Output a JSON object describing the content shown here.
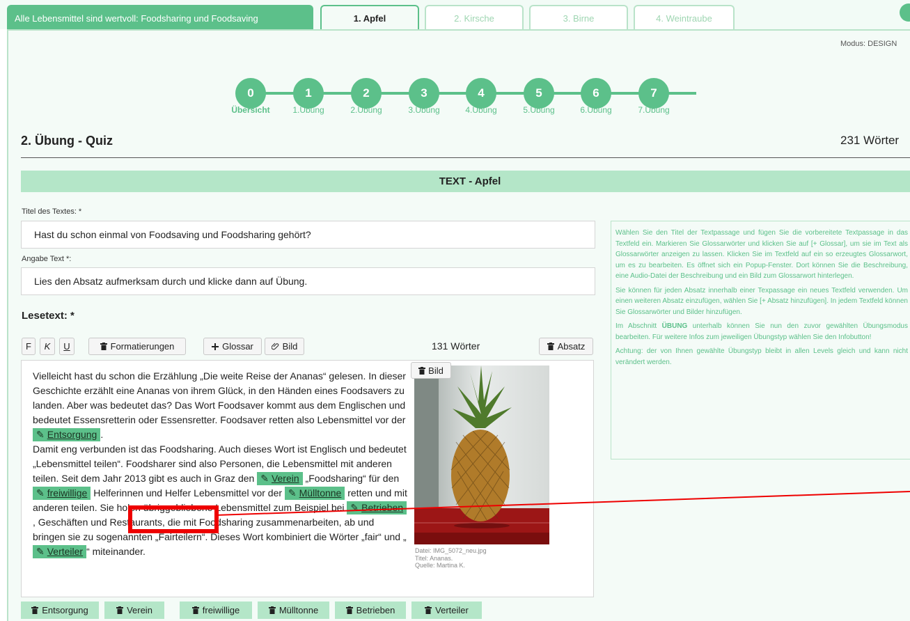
{
  "tabs": [
    {
      "label": "Alle Lebensmittel sind wertvoll: Foodsharing und Foodsaving"
    },
    {
      "label": "1. Apfel"
    },
    {
      "label": "2. Kirsche"
    },
    {
      "label": "3. Birne"
    },
    {
      "label": "4. Weintraube"
    }
  ],
  "mode_label": "Modus: DESIGN",
  "steps": [
    {
      "num": "0",
      "label": "Übersicht"
    },
    {
      "num": "1",
      "label": "1.Übung"
    },
    {
      "num": "2",
      "label": "2.Übung"
    },
    {
      "num": "3",
      "label": "3.Übung"
    },
    {
      "num": "4",
      "label": "4.Übung"
    },
    {
      "num": "5",
      "label": "5.Übung"
    },
    {
      "num": "6",
      "label": "6.Übung"
    },
    {
      "num": "7",
      "label": "7.Übung"
    }
  ],
  "exercise_title": "2. Übung - Quiz",
  "word_total": "231 Wörter",
  "text_header": "TEXT - Apfel",
  "title_field": {
    "label": "Titel des Textes: *",
    "value": "Hast du schon einmal von Foodsaving und Foodsharing gehört?"
  },
  "task_field": {
    "label": "Angabe Text *:",
    "value": "Lies den Absatz aufmerksam durch und klicke dann auf Übung."
  },
  "lesetext_label": "Lesetext: *",
  "toolbar": {
    "bold": "F",
    "italic": "K",
    "underline": "U",
    "format_label": "Formatierungen",
    "glossar_label": "Glossar",
    "bild_label": "Bild",
    "word_count": "131 Wörter",
    "absatz_label": "Absatz"
  },
  "reading_text": {
    "p1": "Vielleicht hast du schon die Erzählung „Die weite Reise der Ananas“ gelesen. In dieser Geschichte erzählt eine Ananas von ihrem Glück, in den Händen eines Foodsavers zu landen. Aber was bedeutet das? Das Wort Foodsaver kommt aus dem Englischen und bedeutet Essensretterin oder Essensretter. Foodsaver retten also Lebensmittel vor der",
    "p2": "Damit eng verbunden ist das Foodsharing. Auch dieses Wort ist Englisch und bedeutet „Lebensmittel teilen“. Foodsharer sind also Personen, die Lebensmittel mit anderen teilen. Seit dem Jahr 2013 gibt es auch in Graz den",
    "s3": "„Foodsharing“ für den",
    "s4": "Helferinnen und Helfer Lebensmittel vor der",
    "s5": "retten und mit anderen teilen. Sie holen übriggebliebene Lebensmittel zum Beispiel bei",
    "s6": ", Geschäften und Restaurants, die mit Foodsharing zusammenarbeiten, ab und bringen sie zu sogenannten „Fairteilern“. Dieses Wort kombiniert die Wörter „fair“ und „",
    "s7": "“ miteinander."
  },
  "glossary_words": [
    "Entsorgung",
    "Verein",
    "freiwillige",
    "Mülltonne",
    "Betrieben",
    "Verteiler"
  ],
  "image": {
    "button_label": "Bild",
    "file": "Datei: IMG_5072_neu.jpg",
    "title": "Titel: Ananas.",
    "source": "Quelle: Martina K."
  },
  "info_box": {
    "p1": "Wählen Sie den Titel der Textpassage und fügen Sie die vorbereitete Textpassage in das Textfeld ein. Markieren Sie Glossarwörter und klicken Sie auf [+ Glossar], um sie im Text als Glossarwörter anzeigen zu lassen. Klicken Sie im Textfeld auf ein so erzeugtes Glossarwort, um es zu bearbeiten. Es öffnet sich ein Popup-Fenster. Dort können Sie die Beschreibung, eine Audio-Datei der Beschreibung und ein Bild zum Glossarwort hinterlegen.",
    "p2": "Sie können für jeden Absatz innerhalb einer Texpassage ein neues Textfeld verwenden. Um einen weiteren Absatz einzufügen, wählen Sie [+ Absatz hinzufügen]. In jedem Textfeld können Sie Glossarwörter und Bilder hinzufügen.",
    "p3_pre": "Im Abschnitt ",
    "p3_strong": "ÜBUNG",
    "p3_post": " unterhalb können Sie nun den zuvor gewählten Übungsmodus bearbeiten. Für weitere Infos zum jeweiligen Übungstyp wählen Sie den Infobutton!",
    "p4": "Achtung: der von Ihnen gewählte Übungstyp bleibt in allen Levels gleich und kann nicht verändert werden."
  },
  "colors": {
    "accent": "#5cc08a",
    "light_accent": "#b4e6c8",
    "highlight": "#ee0000"
  }
}
